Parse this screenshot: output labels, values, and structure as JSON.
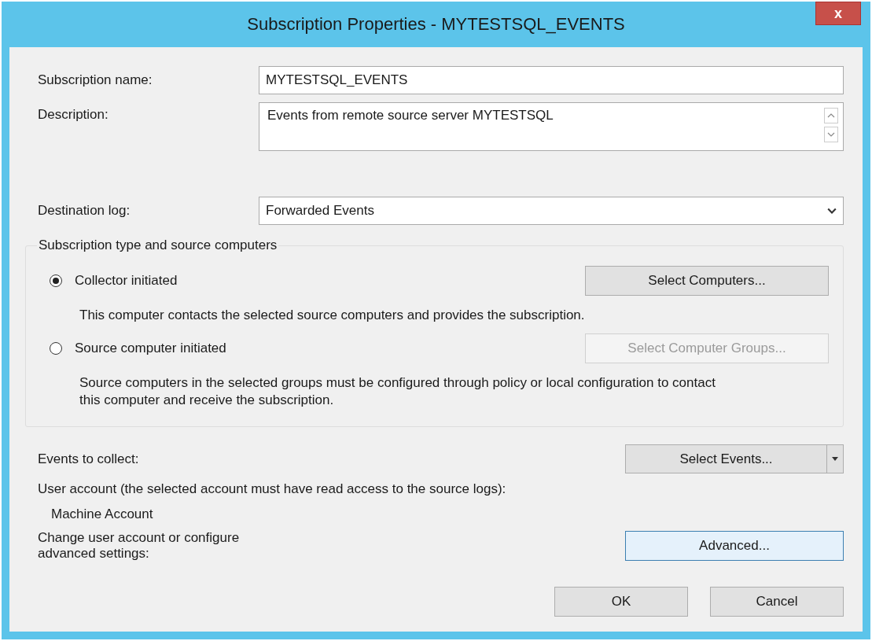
{
  "window": {
    "title": "Subscription Properties - MYTESTSQL_EVENTS",
    "close": "x"
  },
  "fields": [
    {
      "kind": "text",
      "label": "Subscription name:",
      "value": "MYTESTSQL_EVENTS"
    },
    {
      "kind": "multiline",
      "label": "Description:",
      "value": "Events from remote source server MYTESTSQL"
    },
    {
      "kind": "dropdown",
      "label": "Destination log:",
      "value": "Forwarded Events"
    }
  ],
  "group": {
    "title": "Subscription type and source computers",
    "options": [
      {
        "label": "Collector initiated",
        "selected": true,
        "button": {
          "label": "Select Computers...",
          "disabled": false
        },
        "note": "This computer contacts the selected source computers and provides the subscription."
      },
      {
        "label": "Source computer initiated",
        "selected": false,
        "button": {
          "label": "Select Computer Groups...",
          "disabled": true
        },
        "note": "Source computers in the selected groups must be configured through policy or local configuration to contact this computer and receive the subscription."
      }
    ]
  },
  "events": {
    "label": "Events to collect:",
    "button": "Select Events..."
  },
  "account": {
    "label": "User account (the selected account must have read access to the source logs):",
    "value": "Machine Account"
  },
  "advanced": {
    "label": "Change user account or configure advanced settings:",
    "button": "Advanced...",
    "focused": true
  },
  "buttons": [
    "OK",
    "Cancel"
  ]
}
